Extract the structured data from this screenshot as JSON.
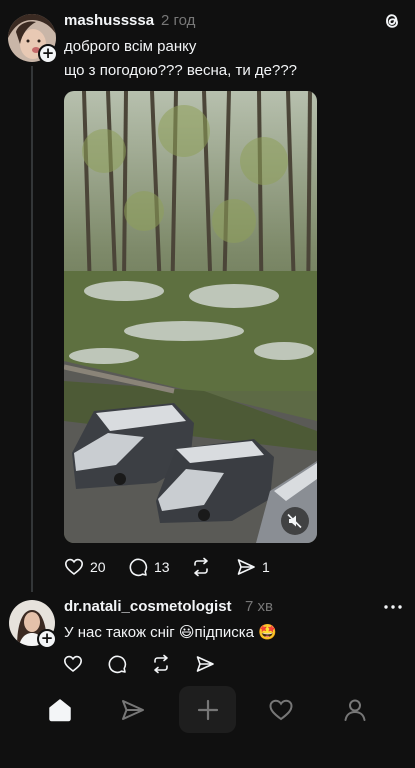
{
  "post1": {
    "username": "mashussssa",
    "time": "2 год",
    "lines": [
      "доброго всім ранку",
      "що з погодою??? весна, ти де???"
    ],
    "stats": {
      "likes": "20",
      "replies": "13",
      "shares": "1"
    }
  },
  "post2": {
    "username": "dr.natali_cosmetologist",
    "time": "7 хв",
    "text": "У нас також сніг 😃підписка 🤩"
  },
  "icons": {
    "like": "heart-icon",
    "reply": "comment-icon",
    "repost": "repost-icon",
    "share": "send-icon",
    "more": "more-dots-icon",
    "logo": "threads-logo-icon"
  },
  "nav": [
    "home",
    "search",
    "create",
    "activity",
    "profile"
  ],
  "colors": {
    "background": "#101010",
    "text": "#f3f5f7",
    "muted": "#777777",
    "line": "#333638"
  }
}
